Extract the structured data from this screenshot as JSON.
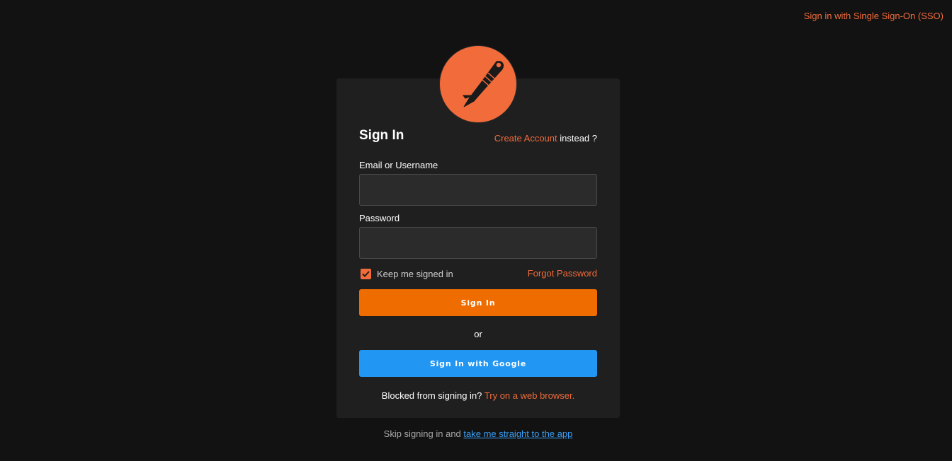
{
  "header": {
    "sso_link": "Sign in with Single Sign-On (SSO)"
  },
  "logo": {
    "icon": "postman-astronaut-logo",
    "color": "#f26b3a"
  },
  "form": {
    "title": "Sign In",
    "create_account_link": "Create Account",
    "create_account_suffix": " instead ?",
    "email_label": "Email or Username",
    "email_value": "",
    "email_placeholder": "",
    "password_label": "Password",
    "password_value": "",
    "password_placeholder": "",
    "keep_signed_in_label": "Keep me signed in",
    "keep_signed_in_checked": true,
    "forgot_password_link": "Forgot Password",
    "sign_in_button": "Sign In",
    "or_separator": "or",
    "google_button": "Sign In with Google",
    "blocked_text": "Blocked from signing in? ",
    "blocked_link": "Try on a web browser."
  },
  "footer": {
    "skip_text": "Skip signing in and ",
    "skip_link": "take me straight to the app"
  },
  "colors": {
    "background": "#121212",
    "card": "#1f1f1f",
    "accent_orange": "#ef6c00",
    "link_orange": "#f26b3a",
    "google_blue": "#2196f3",
    "link_blue": "#3b9ef5"
  }
}
